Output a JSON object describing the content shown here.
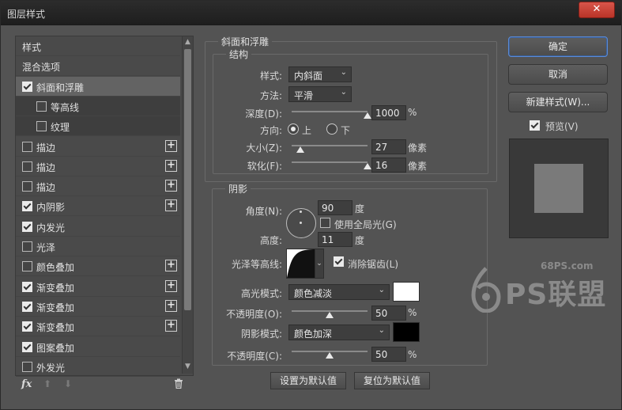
{
  "window": {
    "title": "图层样式",
    "close_glyph": "✕"
  },
  "sidebar": {
    "items": [
      {
        "label": "样式",
        "checkbox": null,
        "plus": false,
        "state": "normal"
      },
      {
        "label": "混合选项",
        "checkbox": null,
        "plus": false,
        "state": "normal"
      },
      {
        "label": "斜面和浮雕",
        "checkbox": true,
        "plus": false,
        "state": "selected"
      },
      {
        "label": "等高线",
        "checkbox": false,
        "plus": false,
        "state": "sub"
      },
      {
        "label": "纹理",
        "checkbox": false,
        "plus": false,
        "state": "sub"
      },
      {
        "label": "描边",
        "checkbox": false,
        "plus": true,
        "state": "normal"
      },
      {
        "label": "描边",
        "checkbox": false,
        "plus": true,
        "state": "normal"
      },
      {
        "label": "描边",
        "checkbox": false,
        "plus": true,
        "state": "normal"
      },
      {
        "label": "内阴影",
        "checkbox": true,
        "plus": true,
        "state": "normal"
      },
      {
        "label": "内发光",
        "checkbox": true,
        "plus": false,
        "state": "normal"
      },
      {
        "label": "光泽",
        "checkbox": false,
        "plus": false,
        "state": "normal"
      },
      {
        "label": "颜色叠加",
        "checkbox": false,
        "plus": true,
        "state": "normal"
      },
      {
        "label": "渐变叠加",
        "checkbox": true,
        "plus": true,
        "state": "normal"
      },
      {
        "label": "渐变叠加",
        "checkbox": true,
        "plus": true,
        "state": "normal"
      },
      {
        "label": "渐变叠加",
        "checkbox": true,
        "plus": true,
        "state": "normal"
      },
      {
        "label": "图案叠加",
        "checkbox": true,
        "plus": false,
        "state": "normal"
      },
      {
        "label": "外发光",
        "checkbox": false,
        "plus": false,
        "state": "normal"
      }
    ],
    "fx_label": "fx",
    "up_glyph": "⬆",
    "down_glyph": "⬇",
    "trash_glyph": "🗑"
  },
  "bevel": {
    "section_title": "斜面和浮雕",
    "structure_title": "结构",
    "style_label": "样式:",
    "style_value": "内斜面",
    "technique_label": "方法:",
    "technique_value": "平滑",
    "depth_label": "深度(D):",
    "depth_value": "1000",
    "depth_unit": "%",
    "depth_fraction": 1.0,
    "direction_label": "方向:",
    "direction_up": "上",
    "direction_down": "下",
    "size_label": "大小(Z):",
    "size_value": "27",
    "size_unit": "像素",
    "size_fraction": 0.11,
    "soften_label": "软化(F):",
    "soften_value": "16",
    "soften_unit": "像素",
    "soften_fraction": 1.0
  },
  "shading": {
    "title": "阴影",
    "angle_label": "角度(N):",
    "angle_value": "90",
    "angle_unit": "度",
    "global_light_label": "使用全局光(G)",
    "altitude_label": "高度:",
    "altitude_value": "11",
    "altitude_unit": "度",
    "gloss_label": "光泽等高线:",
    "antialias_label": "消除锯齿(L)",
    "highlight_mode_label": "高光模式:",
    "highlight_mode_value": "颜色减淡",
    "highlight_color": "#ffffff",
    "highlight_opacity_label": "不透明度(O):",
    "highlight_opacity_value": "50",
    "highlight_opacity_fraction": 0.5,
    "shadow_mode_label": "阴影模式:",
    "shadow_mode_value": "颜色加深",
    "shadow_color": "#000000",
    "shadow_opacity_label": "不透明度(C):",
    "shadow_opacity_value": "50",
    "shadow_opacity_fraction": 0.5,
    "percent_unit": "%",
    "set_default": "设置为默认值",
    "reset_default": "复位为默认值"
  },
  "actions": {
    "ok": "确定",
    "cancel": "取消",
    "new_style": "新建样式(W)...",
    "preview_label": "预览(V)",
    "preview_checked": true
  },
  "watermark": {
    "site": "68PS.com",
    "brand": "PS联盟"
  }
}
